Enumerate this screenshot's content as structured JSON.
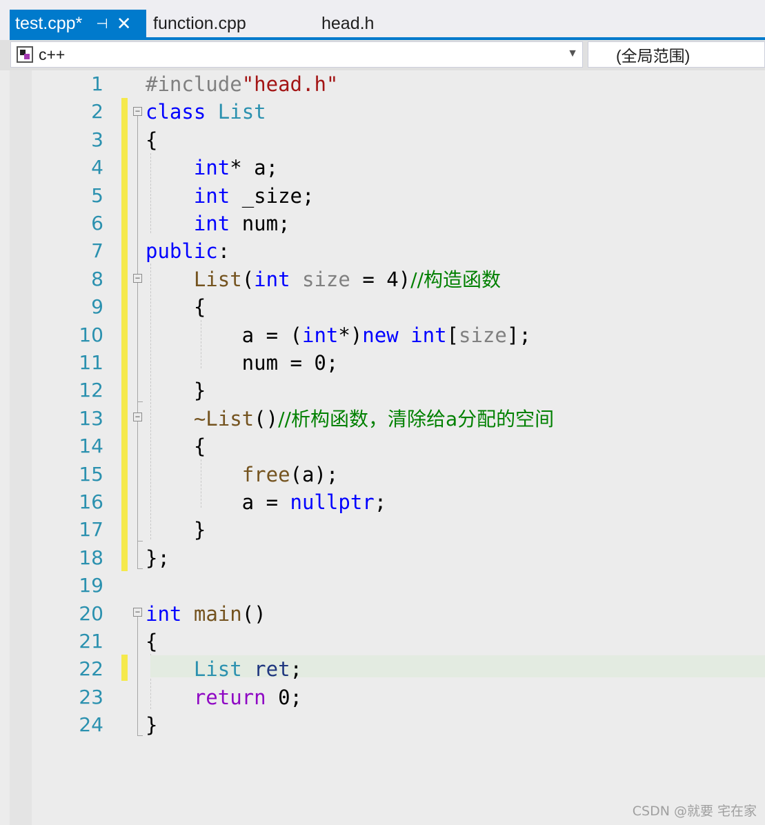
{
  "tabs": [
    {
      "label": "test.cpp*",
      "active": true
    },
    {
      "label": "function.cpp",
      "active": false
    },
    {
      "label": "head.h",
      "active": false
    }
  ],
  "tab_pin_glyph": "⊣",
  "tab_close_glyph": "✕",
  "navbar": {
    "project": "c++",
    "scope": "(全局范围)"
  },
  "colors": {
    "accent": "#007acc",
    "keyword": "#0000ff",
    "type": "#2b91af",
    "function": "#74531f",
    "string": "#a31515",
    "comment": "#008000",
    "control_flow": "#8f08c4",
    "change_bar": "#f5e94c"
  },
  "code_lines": [
    {
      "n": "1",
      "tokens": [
        {
          "c": "pp",
          "t": "#include"
        },
        {
          "c": "str",
          "t": "\"head.h\""
        }
      ]
    },
    {
      "n": "2",
      "tokens": [
        {
          "c": "kw",
          "t": "class"
        },
        {
          "c": "",
          "t": " "
        },
        {
          "c": "ty",
          "t": "List"
        }
      ]
    },
    {
      "n": "3",
      "tokens": [
        {
          "c": "",
          "t": "{"
        }
      ]
    },
    {
      "n": "4",
      "tokens": [
        {
          "c": "",
          "t": "    "
        },
        {
          "c": "kw",
          "t": "int"
        },
        {
          "c": "",
          "t": "* a;"
        }
      ]
    },
    {
      "n": "5",
      "tokens": [
        {
          "c": "",
          "t": "    "
        },
        {
          "c": "kw",
          "t": "int"
        },
        {
          "c": "",
          "t": " _size;"
        }
      ]
    },
    {
      "n": "6",
      "tokens": [
        {
          "c": "",
          "t": "    "
        },
        {
          "c": "kw",
          "t": "int"
        },
        {
          "c": "",
          "t": " num;"
        }
      ]
    },
    {
      "n": "7",
      "tokens": [
        {
          "c": "kw",
          "t": "public"
        },
        {
          "c": "",
          "t": ":"
        }
      ]
    },
    {
      "n": "8",
      "tokens": [
        {
          "c": "",
          "t": "    "
        },
        {
          "c": "fn",
          "t": "List"
        },
        {
          "c": "",
          "t": "("
        },
        {
          "c": "kw",
          "t": "int"
        },
        {
          "c": "",
          "t": " "
        },
        {
          "c": "par",
          "t": "size"
        },
        {
          "c": "",
          "t": " = 4)"
        },
        {
          "c": "cm",
          "t": "//构造函数"
        }
      ]
    },
    {
      "n": "9",
      "tokens": [
        {
          "c": "",
          "t": "    {"
        }
      ]
    },
    {
      "n": "10",
      "tokens": [
        {
          "c": "",
          "t": "        a = ("
        },
        {
          "c": "kw",
          "t": "int"
        },
        {
          "c": "",
          "t": "*)"
        },
        {
          "c": "kw",
          "t": "new"
        },
        {
          "c": "",
          "t": " "
        },
        {
          "c": "kw",
          "t": "int"
        },
        {
          "c": "",
          "t": "["
        },
        {
          "c": "par",
          "t": "size"
        },
        {
          "c": "",
          "t": "];"
        }
      ]
    },
    {
      "n": "11",
      "tokens": [
        {
          "c": "",
          "t": "        num = 0;"
        }
      ]
    },
    {
      "n": "12",
      "tokens": [
        {
          "c": "",
          "t": "    }"
        }
      ]
    },
    {
      "n": "13",
      "tokens": [
        {
          "c": "",
          "t": "    "
        },
        {
          "c": "fn",
          "t": "~List"
        },
        {
          "c": "",
          "t": "()"
        },
        {
          "c": "cm",
          "t": "//析构函数，清除给a分配的空间"
        }
      ]
    },
    {
      "n": "14",
      "tokens": [
        {
          "c": "",
          "t": "    {"
        }
      ]
    },
    {
      "n": "15",
      "tokens": [
        {
          "c": "",
          "t": "        "
        },
        {
          "c": "fn",
          "t": "free"
        },
        {
          "c": "",
          "t": "(a);"
        }
      ]
    },
    {
      "n": "16",
      "tokens": [
        {
          "c": "",
          "t": "        a = "
        },
        {
          "c": "kw",
          "t": "nullptr"
        },
        {
          "c": "",
          "t": ";"
        }
      ]
    },
    {
      "n": "17",
      "tokens": [
        {
          "c": "",
          "t": "    }"
        }
      ]
    },
    {
      "n": "18",
      "tokens": [
        {
          "c": "",
          "t": "};"
        }
      ]
    },
    {
      "n": "19",
      "tokens": []
    },
    {
      "n": "20",
      "tokens": [
        {
          "c": "kw",
          "t": "int"
        },
        {
          "c": "",
          "t": " "
        },
        {
          "c": "fn",
          "t": "main"
        },
        {
          "c": "",
          "t": "()"
        }
      ]
    },
    {
      "n": "21",
      "tokens": [
        {
          "c": "",
          "t": "{"
        }
      ]
    },
    {
      "n": "22",
      "tokens": [
        {
          "c": "",
          "t": "    "
        },
        {
          "c": "ty",
          "t": "List"
        },
        {
          "c": "",
          "t": " "
        },
        {
          "c": "var",
          "t": "ret"
        },
        {
          "c": "",
          "t": ";"
        }
      ]
    },
    {
      "n": "23",
      "tokens": [
        {
          "c": "",
          "t": "    "
        },
        {
          "c": "flow",
          "t": "return"
        },
        {
          "c": "",
          "t": " 0;"
        }
      ]
    },
    {
      "n": "24",
      "tokens": [
        {
          "c": "",
          "t": "}"
        }
      ]
    }
  ],
  "current_line": "22",
  "watermark": "CSDN @就要 宅在家"
}
